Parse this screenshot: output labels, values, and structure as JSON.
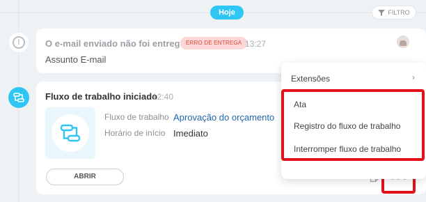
{
  "header": {
    "today_label": "Hoje",
    "filter_label": "FILTRO"
  },
  "email_card": {
    "title": "O e-mail enviado não foi entregue",
    "badge": "ERRO DE ENTREGA",
    "time": "13:27",
    "subject": "Assunto E-mail"
  },
  "flow_card": {
    "title": "Fluxo de trabalho iniciado",
    "time": "12:40",
    "fields": [
      {
        "label": "Fluxo de trabalho",
        "value": "Aprovação do orçamento"
      },
      {
        "label": "Horário de início",
        "value": "Imediato"
      }
    ],
    "open_button": "ABRIR"
  },
  "popup_menu": {
    "extensions_label": "Extensões",
    "items": [
      {
        "label": "Ata"
      },
      {
        "label": "Registro do fluxo de trabalho"
      },
      {
        "label": "Interromper fluxo de trabalho"
      }
    ]
  },
  "colors": {
    "accent": "#2fc6f6",
    "error_text": "#e0493b",
    "error_bg": "#fdd6d6",
    "highlight": "#e3111b",
    "link": "#2066b0"
  },
  "icons": {
    "filter": "filter-icon",
    "warning": "warning-icon",
    "flow": "workflow-icon",
    "more": "more-dots-icon",
    "note": "note-icon",
    "chevron": "chevron-right-icon"
  }
}
